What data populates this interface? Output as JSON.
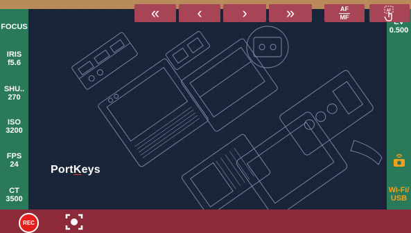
{
  "left_panel": {
    "focus": "FOCUS",
    "iris_label": "IRIS",
    "iris_value": "f5.6",
    "shutter_label": "SHU..",
    "shutter_value": "270",
    "iso_label": "ISO",
    "iso_value": "3200",
    "fps_label": "FPS",
    "fps_value": "24",
    "ct_label": "CT",
    "ct_value": "3500"
  },
  "right_panel": {
    "ev_label": "EV",
    "ev_value": "0.500",
    "camera_icon": "camera-connection-icon",
    "connection_line1": "Wi-Fi/",
    "connection_line2": "USB",
    "accent_color": "#f2a11f"
  },
  "preview": {
    "logo_part1": "Port",
    "logo_k": "K",
    "logo_part2": "eys"
  },
  "bottom_bar": {
    "rec_label": "REC",
    "focus_icon": "focus-frame-icon",
    "rewind_fast": "«",
    "rewind": "‹",
    "forward": "›",
    "forward_fast": "»",
    "af_label": "AF",
    "mf_label": "MF",
    "touch_icon": "touch-af-icon"
  },
  "colors": {
    "side_panel": "#2a7a5a",
    "bottom_bar": "#8c2a3a",
    "button": "#a74556",
    "rec": "#e3201b",
    "frame": "#b98b5b",
    "preview_bg": "#1a2438"
  }
}
